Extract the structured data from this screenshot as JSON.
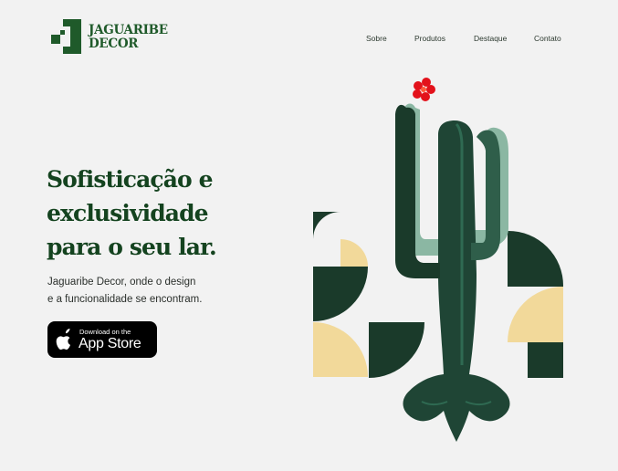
{
  "brand": {
    "name_line1": "JAGUARIBE",
    "name_line2": "DECOR",
    "color": "#1f5a2a"
  },
  "nav": {
    "items": [
      {
        "label": "Sobre"
      },
      {
        "label": "Produtos"
      },
      {
        "label": "Destaque"
      },
      {
        "label": "Contato"
      }
    ]
  },
  "hero": {
    "title_line1": "Sofisticação e",
    "title_line2": "exclusividade",
    "title_line3": "para o seu lar.",
    "subtitle_line1": "Jaguaribe Decor, onde o design",
    "subtitle_line2": "e a funcionalidade se encontram."
  },
  "appstore": {
    "small_label": "Download on the",
    "big_label": "App Store",
    "icon": "apple-icon"
  },
  "illustration": {
    "icon": "cactus-illustration",
    "colors": {
      "dark_green": "#1a3a2a",
      "cactus_green": "#2f5e4a",
      "light_green": "#8bb7a3",
      "cream": "#f2d99a",
      "flower_red": "#e3121b"
    }
  }
}
